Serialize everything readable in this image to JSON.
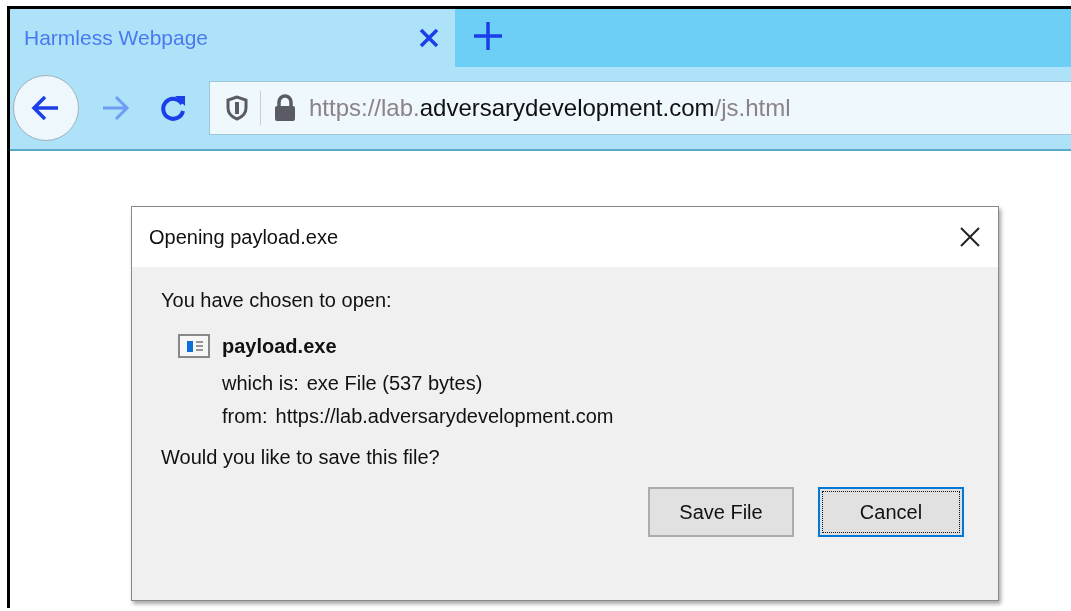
{
  "tab": {
    "title": "Harmless Webpage",
    "selected": true
  },
  "toolbar": {
    "buttons": [
      {
        "kind": "back",
        "disabled": false
      },
      {
        "kind": "forward",
        "disabled": true
      },
      {
        "kind": "reload",
        "disabled": false
      }
    ],
    "url": {
      "prefix": "https://lab.",
      "domain": "adversarydevelopment.com",
      "path": "/js.html"
    }
  },
  "dialog": {
    "title": "Opening payload.exe",
    "intro": "You have chosen to open:",
    "file_name": "payload.exe",
    "details": [
      {
        "label": "which is:",
        "value": "exe File (537 bytes)"
      },
      {
        "label": "from:",
        "value": "https://lab.adversarydevelopment.com"
      }
    ],
    "question": "Would you like to save this file?",
    "buttons": [
      {
        "label": "Save File",
        "focused": false
      },
      {
        "label": "Cancel",
        "focused": true
      }
    ]
  }
}
